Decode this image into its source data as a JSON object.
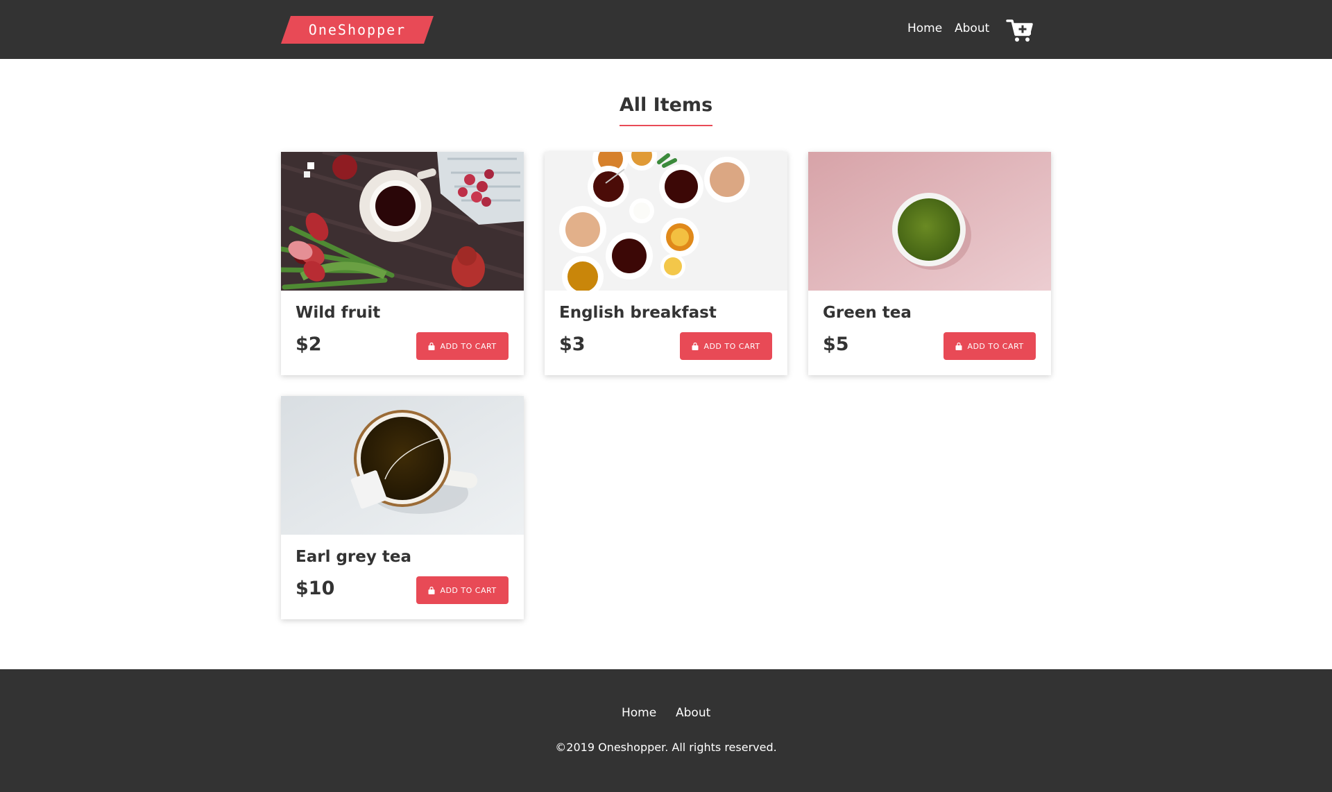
{
  "header": {
    "logo_text": "OneShopper",
    "nav": {
      "home": "Home",
      "about": "About"
    },
    "cart_icon": "cart-plus-icon"
  },
  "main": {
    "title": "All Items",
    "products": [
      {
        "name": "Wild fruit",
        "price": "$2",
        "button": "ADD TO CART"
      },
      {
        "name": "English breakfast",
        "price": "$3",
        "button": "ADD TO CART"
      },
      {
        "name": "Green tea",
        "price": "$5",
        "button": "ADD TO CART"
      },
      {
        "name": "Earl grey tea",
        "price": "$10",
        "button": "ADD TO CART"
      }
    ]
  },
  "footer": {
    "nav": {
      "home": "Home",
      "about": "About"
    },
    "copyright": "©2019 Oneshopper. All rights reserved."
  },
  "colors": {
    "accent": "#e84a56",
    "dark": "#333333",
    "background": "#ffffff"
  }
}
